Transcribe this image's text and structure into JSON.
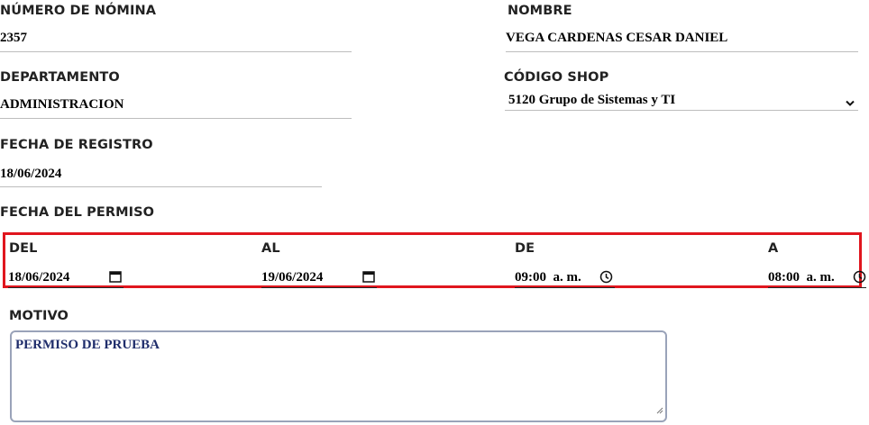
{
  "form": {
    "nomina": {
      "label": "NÚMERO DE NÓMINA",
      "value": "2357"
    },
    "nombre": {
      "label": "NOMBRE",
      "value": "VEGA CARDENAS CESAR DANIEL"
    },
    "departamento": {
      "label": "DEPARTAMENTO",
      "value": "ADMINISTRACION"
    },
    "codigo_shop": {
      "label": "CÓDIGO SHOP",
      "value": "5120 Grupo de Sistemas y TI"
    },
    "fecha_registro": {
      "label": "FECHA DE REGISTRO",
      "value": "18/06/2024"
    },
    "fecha_permiso": {
      "label": "FECHA DEL PERMISO"
    },
    "del": {
      "label": "DEL",
      "value": "18/06/2024"
    },
    "al": {
      "label": "AL",
      "value": "19/06/2024"
    },
    "de": {
      "label": "DE",
      "value": "09:00  a. m."
    },
    "a": {
      "label": "A",
      "value": "08:00  a. m."
    },
    "motivo": {
      "label": "MOTIVO",
      "value": "PERMISO DE PRUEBA"
    }
  },
  "icons": {
    "date": "calendar-icon",
    "time": "clock-icon",
    "select": "chevron-down-icon",
    "resize": "resize-handle-icon"
  },
  "colors": {
    "highlight_border": "#e0161e",
    "textarea_text": "#1f2d6b",
    "textarea_border": "#9aa3b9"
  }
}
